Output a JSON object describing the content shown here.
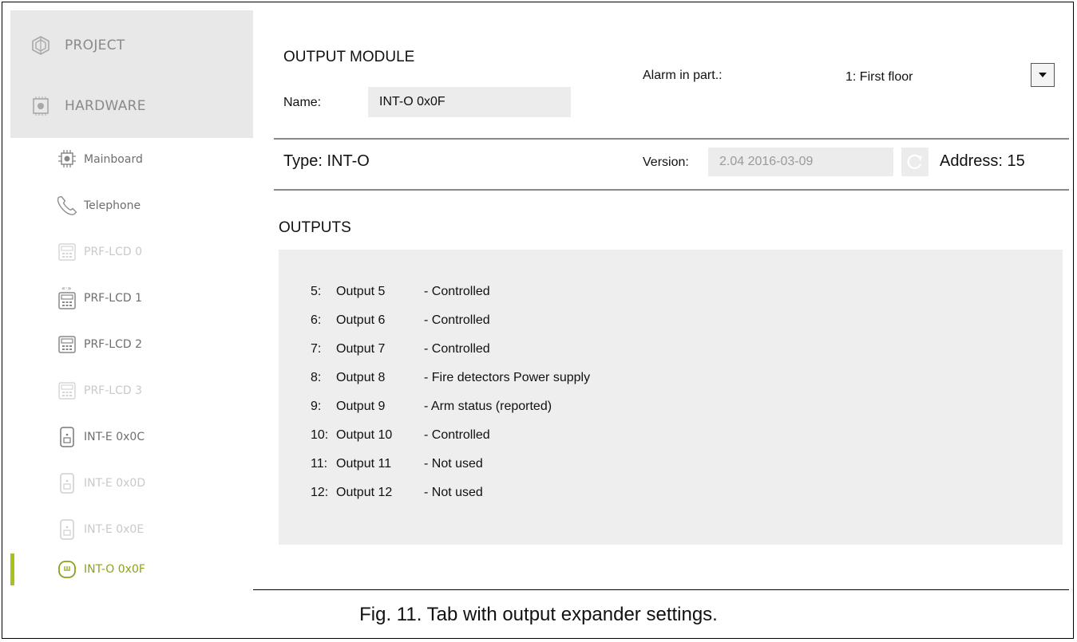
{
  "sidebar": {
    "top": [
      {
        "label": "PROJECT",
        "icon": "project-icon"
      },
      {
        "label": "HARDWARE",
        "icon": "hardware-icon"
      }
    ],
    "items": [
      {
        "label": "Mainboard",
        "icon": "mainboard-icon",
        "dim": false
      },
      {
        "label": "Telephone",
        "icon": "telephone-icon",
        "dim": false
      },
      {
        "label": "PRF-LCD 0",
        "icon": "keypad-icon",
        "dim": true
      },
      {
        "label": "PRF-LCD 1",
        "icon": "wireless-keypad-icon",
        "dim": false
      },
      {
        "label": "PRF-LCD 2",
        "icon": "keypad-icon",
        "dim": false
      },
      {
        "label": "PRF-LCD 3",
        "icon": "keypad-icon",
        "dim": true
      },
      {
        "label": "INT-E 0x0C",
        "icon": "expander-icon",
        "dim": false
      },
      {
        "label": "INT-E 0x0D",
        "icon": "expander-icon",
        "dim": true
      },
      {
        "label": "INT-E 0x0E",
        "icon": "expander-icon",
        "dim": true
      },
      {
        "label": "INT-O 0x0F",
        "icon": "output-expander-icon",
        "dim": false,
        "active": true
      }
    ],
    "active_color": "#a9c21a"
  },
  "module": {
    "title": "OUTPUT MODULE",
    "name_label": "Name:",
    "name_value": "INT-O 0x0F",
    "alarm_label": "Alarm in part.:",
    "alarm_value": "1: First floor",
    "type_label": "Type: INT-O",
    "version_label": "Version:",
    "version_value": "2.04 2016-03-09",
    "address_label": "Address: 15"
  },
  "outputs": {
    "title": "OUTPUTS",
    "rows": [
      {
        "num": "5:",
        "name": "Output 5",
        "func": "- Controlled"
      },
      {
        "num": "6:",
        "name": "Output 6",
        "func": "- Controlled"
      },
      {
        "num": "7:",
        "name": "Output 7",
        "func": "- Controlled"
      },
      {
        "num": "8:",
        "name": "Output 8",
        "func": "- Fire detectors Power supply"
      },
      {
        "num": "9:",
        "name": "Output 9",
        "func": "- Arm status (reported)"
      },
      {
        "num": "10:",
        "name": "Output 10",
        "func": "- Controlled"
      },
      {
        "num": "11:",
        "name": "Output 11",
        "func": "- Not used"
      },
      {
        "num": "12:",
        "name": "Output 12",
        "func": "- Not used"
      }
    ]
  },
  "caption": "Fig. 11. Tab with output expander settings."
}
